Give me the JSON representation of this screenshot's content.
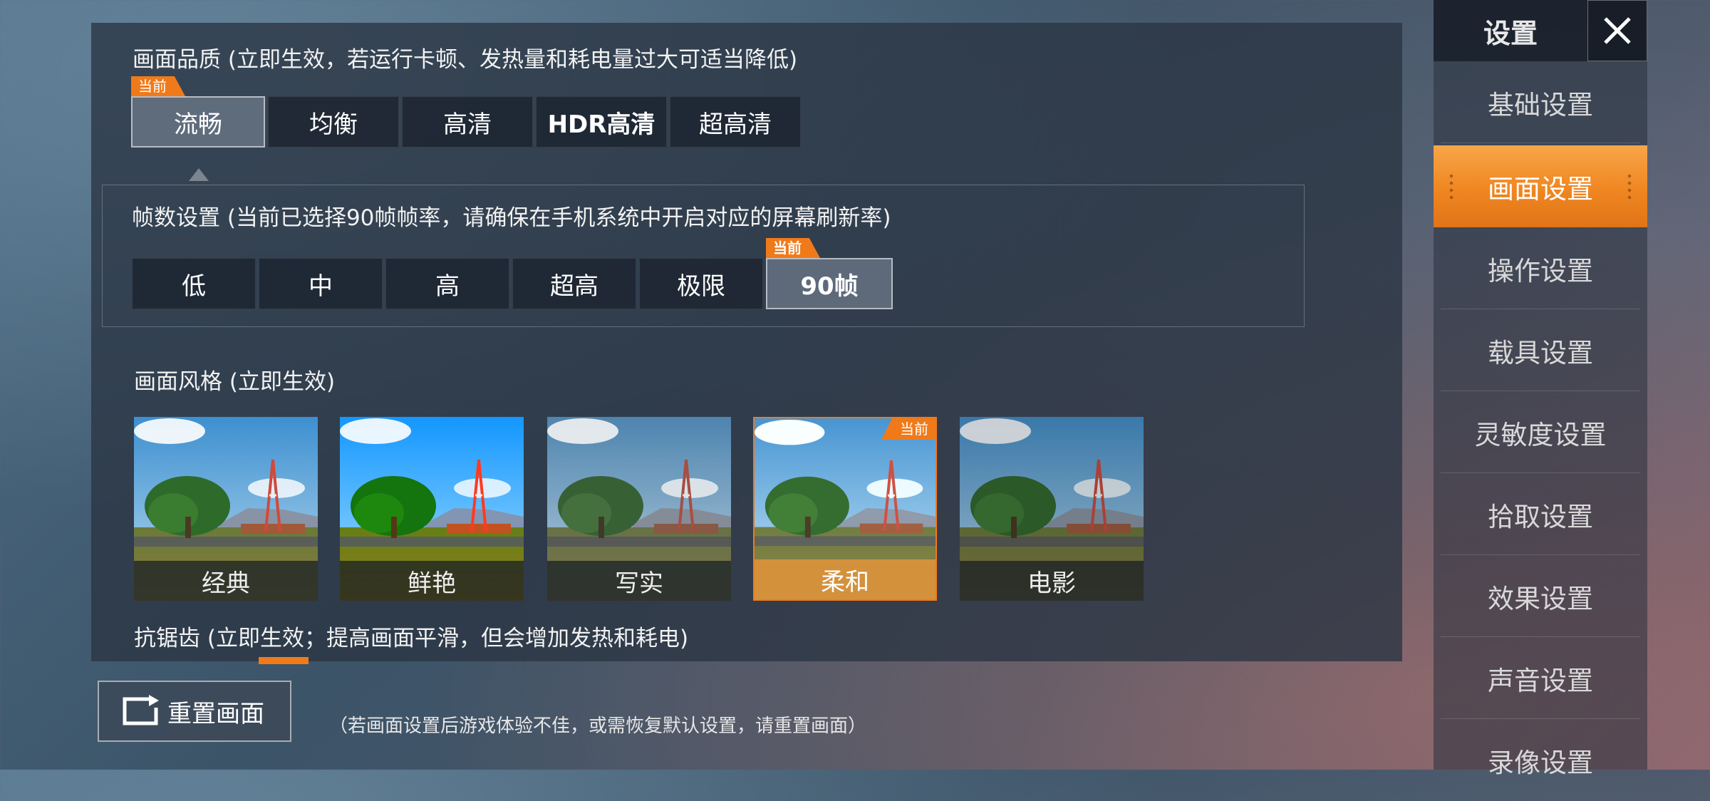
{
  "quality": {
    "title": "画面品质 (立即生效，若运行卡顿、发热量和耗电量过大可适当降低)",
    "options": [
      "流畅",
      "均衡",
      "高清",
      "HDR高清",
      "超高清"
    ],
    "selected": "流畅",
    "current_tag": "当前"
  },
  "fps": {
    "title": "帧数设置 (当前已选择90帧帧率，请确保在手机系统中开启对应的屏幕刷新率)",
    "options": [
      "低",
      "中",
      "高",
      "超高",
      "极限",
      "90帧"
    ],
    "selected": "90帧",
    "current_tag": "当前"
  },
  "style": {
    "title": "画面风格 (立即生效)",
    "options": [
      "经典",
      "鲜艳",
      "写实",
      "柔和",
      "电影"
    ],
    "selected": "柔和",
    "current_tag": "当前"
  },
  "antialias": {
    "title": "抗锯齿 (立即生效；提高画面平滑，但会增加发热和耗电)"
  },
  "reset": {
    "label": "重置画面",
    "note": "（若画面设置后游戏体验不佳，或需恢复默认设置，请重置画面）"
  },
  "sidebar": {
    "title": "设置",
    "items": [
      "基础设置",
      "画面设置",
      "操作设置",
      "载具设置",
      "灵敏度设置",
      "拾取设置",
      "效果设置",
      "声音设置",
      "录像设置"
    ],
    "active": "画面设置"
  },
  "colors": {
    "accent": "#f07a1a",
    "panel": "#2a3442"
  }
}
